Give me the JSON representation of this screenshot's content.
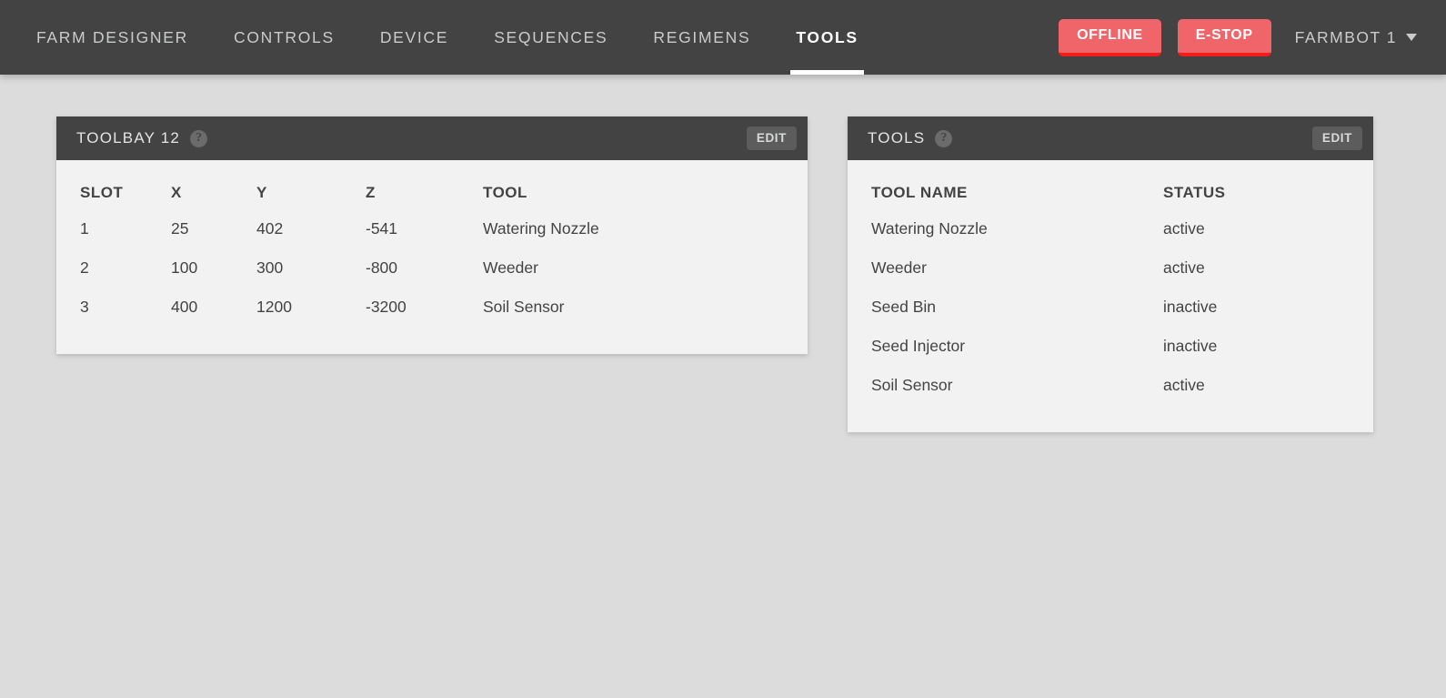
{
  "nav": {
    "links": [
      {
        "label": "Farm Designer",
        "active": false
      },
      {
        "label": "Controls",
        "active": false
      },
      {
        "label": "Device",
        "active": false
      },
      {
        "label": "Sequences",
        "active": false
      },
      {
        "label": "Regimens",
        "active": false
      },
      {
        "label": "Tools",
        "active": true
      }
    ],
    "offline_label": "OFFLINE",
    "estop_label": "E-STOP",
    "device_label": "FARMBOT 1",
    "caret_icon": "chevron-down-icon",
    "offline_color": "#f0656a",
    "estop_color": "#f0656a",
    "accent_border": "#f21d1d"
  },
  "toolbay_panel": {
    "title": "TOOLBAY 12",
    "help_icon": "question-mark-icon",
    "help_glyph": "?",
    "edit_label": "EDIT",
    "columns": [
      "SLOT",
      "X",
      "Y",
      "Z",
      "TOOL"
    ],
    "rows": [
      {
        "slot": "1",
        "x": "25",
        "y": "402",
        "z": "-541",
        "tool": "Watering Nozzle"
      },
      {
        "slot": "2",
        "x": "100",
        "y": "300",
        "z": "-800",
        "tool": "Weeder"
      },
      {
        "slot": "3",
        "x": "400",
        "y": "1200",
        "z": "-3200",
        "tool": "Soil Sensor"
      }
    ]
  },
  "tools_panel": {
    "title": "TOOLS",
    "help_icon": "question-mark-icon",
    "help_glyph": "?",
    "edit_label": "EDIT",
    "columns": [
      "TOOL NAME",
      "STATUS"
    ],
    "rows": [
      {
        "name": "Watering Nozzle",
        "status": "active"
      },
      {
        "name": "Weeder",
        "status": "active"
      },
      {
        "name": "Seed Bin",
        "status": "inactive"
      },
      {
        "name": "Seed Injector",
        "status": "inactive"
      },
      {
        "name": "Soil Sensor",
        "status": "active"
      }
    ]
  }
}
